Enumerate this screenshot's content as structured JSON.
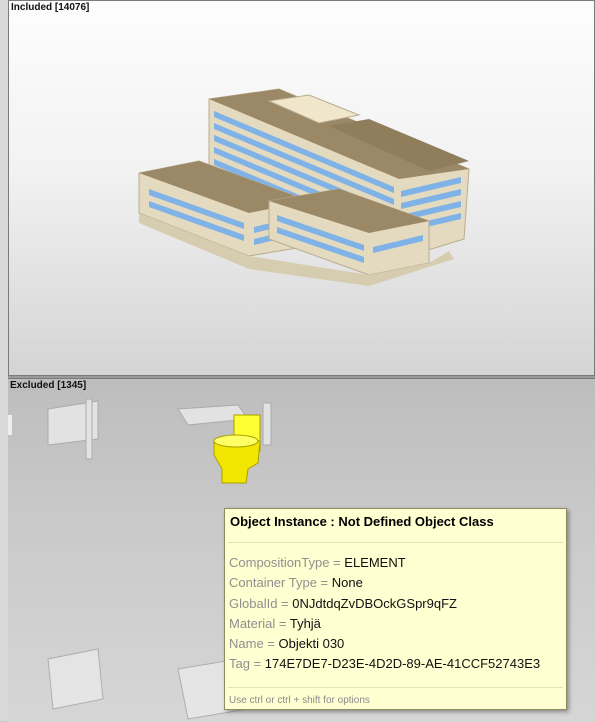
{
  "panes": {
    "included": {
      "title": "Included [14076]"
    },
    "excluded": {
      "title": "Excluded [1345]"
    }
  },
  "tooltip": {
    "title": "Object Instance : Not Defined Object Class",
    "properties": [
      {
        "key": "CompositionType",
        "value": "ELEMENT"
      },
      {
        "key": "Container Type",
        "value": "None"
      },
      {
        "key": "GlobalId",
        "value": "0NJdtdqZvDBOckGSpr9qFZ"
      },
      {
        "key": "Material",
        "value": "Tyhjä"
      },
      {
        "key": "Name",
        "value": "Objekti 030"
      },
      {
        "key": "Tag",
        "value": "174E7DE7-D23E-4D2D-89-AE-41CCF52743E3"
      }
    ],
    "hint": "Use ctrl or ctrl + shift for options"
  },
  "colors": {
    "building_wall": "#e4dac0",
    "building_roof": "#9b8866",
    "window_blue": "#7fb2e6",
    "highlight_yellow": "#ffff00"
  }
}
